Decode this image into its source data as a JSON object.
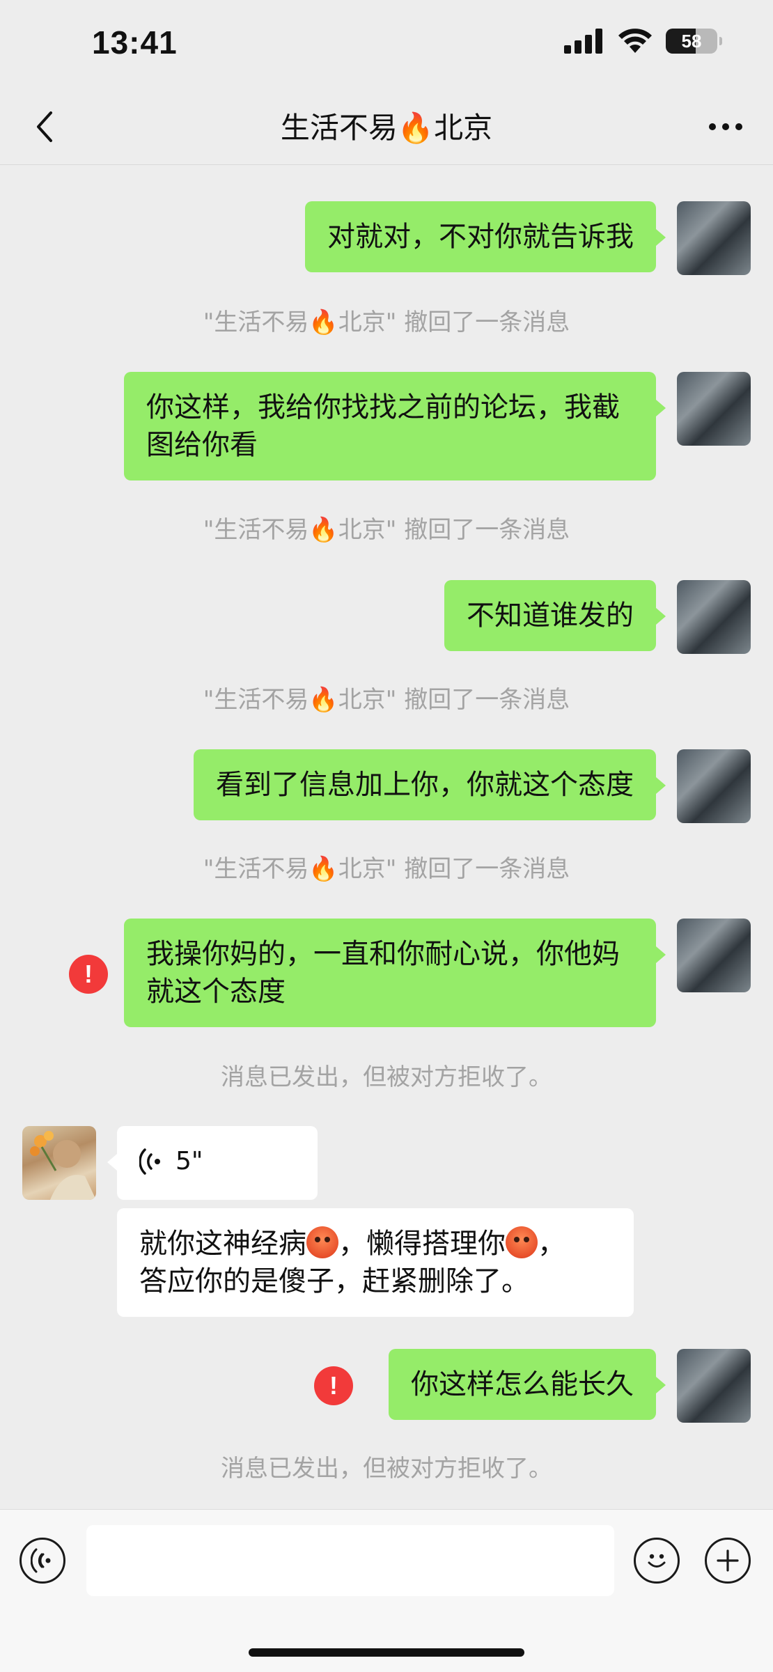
{
  "status_bar": {
    "time": "13:41",
    "battery_level": "58",
    "icons": [
      "signal-icon",
      "wifi-icon",
      "battery-icon"
    ]
  },
  "nav": {
    "title": "生活不易🔥北京",
    "back_icon": "chevron-left-icon",
    "more_icon": "more-icon"
  },
  "messages": [
    {
      "type": "sent",
      "text": "对就对，不对你就告诉我"
    },
    {
      "type": "system",
      "text": "\"生活不易🔥北京\" 撤回了一条消息"
    },
    {
      "type": "sent",
      "text": "你这样，我给你找找之前的论坛，我截图给你看"
    },
    {
      "type": "system",
      "text": "\"生活不易🔥北京\" 撤回了一条消息"
    },
    {
      "type": "sent",
      "text": "不知道谁发的"
    },
    {
      "type": "system",
      "text": "\"生活不易🔥北京\" 撤回了一条消息"
    },
    {
      "type": "sent",
      "text": "看到了信息加上你，你就这个态度"
    },
    {
      "type": "system",
      "text": "\"生活不易🔥北京\" 撤回了一条消息"
    },
    {
      "type": "sent",
      "failed": true,
      "text": "我操你妈的，一直和你耐心说，你他妈就这个态度"
    },
    {
      "type": "system",
      "text": "消息已发出，但被对方拒收了。"
    },
    {
      "type": "received-voice",
      "duration": "5\""
    },
    {
      "type": "received",
      "text_parts": [
        "就你这神经病",
        "，懒得搭理你",
        "，",
        "答应你的是傻子，赶紧删除了。"
      ]
    },
    {
      "type": "sent",
      "failed": true,
      "text": "你这样怎么能长久"
    },
    {
      "type": "system",
      "text": "消息已发出，但被对方拒收了。"
    }
  ],
  "input_bar": {
    "text_value": "",
    "left_icon": "voice-input-icon",
    "emoji_icon": "emoji-icon",
    "plus_icon": "plus-icon"
  },
  "colors": {
    "background": "#ededed",
    "sent_bubble": "#95ec69",
    "received_bubble": "#ffffff",
    "failed_icon": "#f23a3a",
    "system_text": "#a3a3a3"
  }
}
